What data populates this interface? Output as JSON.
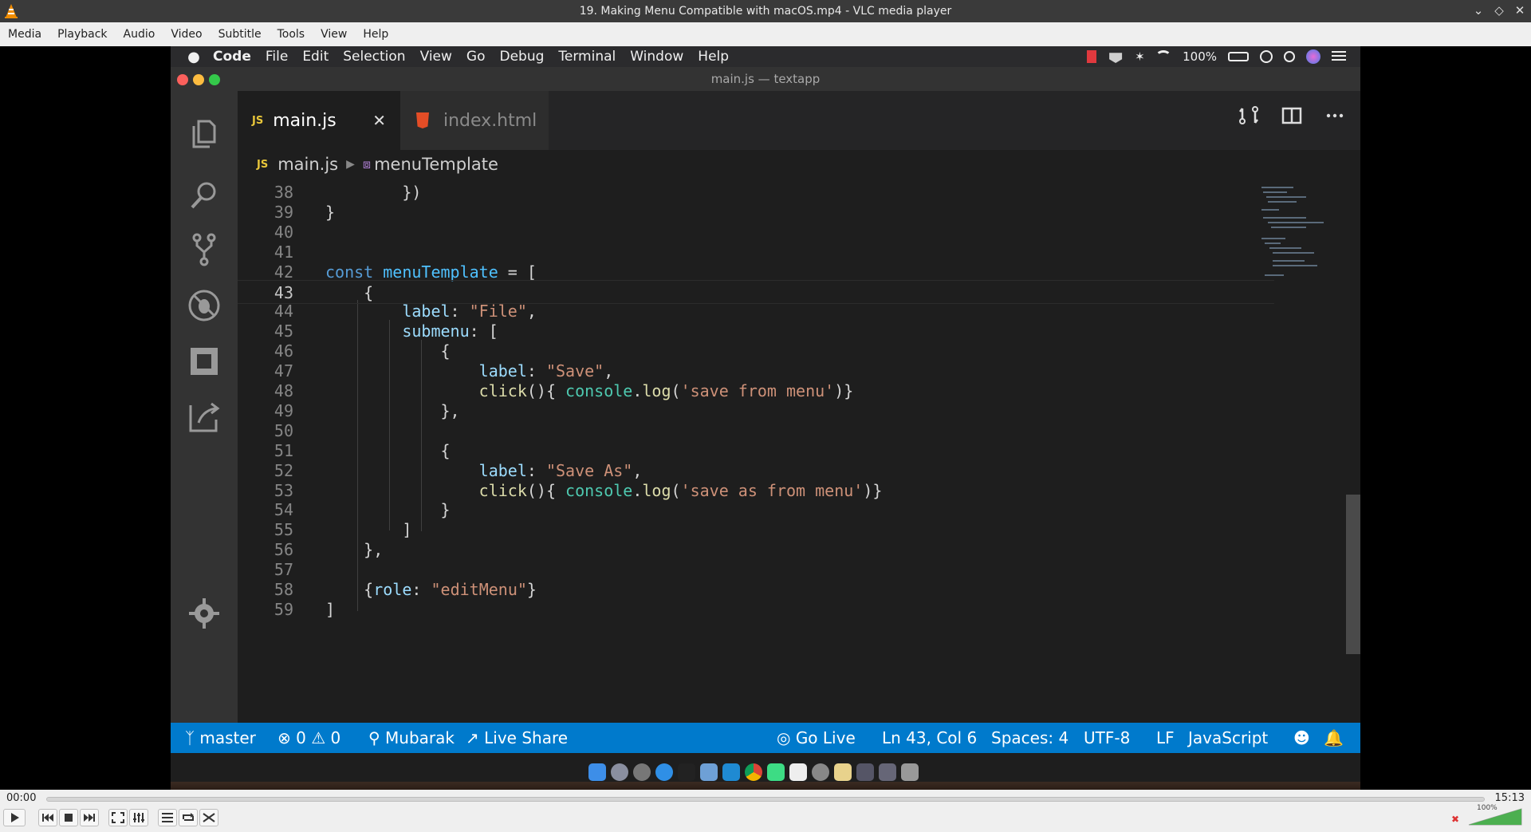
{
  "vlc": {
    "window_title": "19. Making Menu Compatible with macOS.mp4 - VLC media player",
    "menu": [
      "Media",
      "Playback",
      "Audio",
      "Video",
      "Subtitle",
      "Tools",
      "View",
      "Help"
    ],
    "time_elapsed": "00:00",
    "time_total": "15:13",
    "volume_label": "100%",
    "progress": 0.0,
    "volume": 1.0
  },
  "mac_menubar": {
    "items": [
      "Code",
      "File",
      "Edit",
      "Selection",
      "View",
      "Go",
      "Debug",
      "Terminal",
      "Window",
      "Help"
    ],
    "battery": "100%"
  },
  "vscode": {
    "window_title": "main.js — textapp",
    "tabs": [
      {
        "label": "main.js",
        "badge": "JS",
        "active": true
      },
      {
        "label": "index.html",
        "badge": "",
        "active": false
      }
    ],
    "breadcrumb": {
      "file": "main.js",
      "symbol": "menuTemplate"
    },
    "status": {
      "branch": "master",
      "errors": "0",
      "warnings": "0",
      "user": "Mubarak",
      "live_share": "Live Share",
      "go_live": "Go Live",
      "position": "Ln 43, Col 6",
      "spaces": "Spaces: 4",
      "encoding": "UTF-8",
      "eol": "LF",
      "language": "JavaScript"
    },
    "code_lines": [
      {
        "n": "38",
        "text": "        })"
      },
      {
        "n": "39",
        "text": "}"
      },
      {
        "n": "40",
        "text": ""
      },
      {
        "n": "41",
        "text": ""
      },
      {
        "n": "42",
        "text": "const menuTemplate = ["
      },
      {
        "n": "43",
        "text": "    {"
      },
      {
        "n": "44",
        "text": "        label: \"File\","
      },
      {
        "n": "45",
        "text": "        submenu: ["
      },
      {
        "n": "46",
        "text": "            {"
      },
      {
        "n": "47",
        "text": "                label: \"Save\","
      },
      {
        "n": "48",
        "text": "                click(){ console.log('save from menu')}"
      },
      {
        "n": "49",
        "text": "            },"
      },
      {
        "n": "50",
        "text": ""
      },
      {
        "n": "51",
        "text": "            {"
      },
      {
        "n": "52",
        "text": "                label: \"Save As\","
      },
      {
        "n": "53",
        "text": "                click(){ console.log('save as from menu')}"
      },
      {
        "n": "54",
        "text": "            }"
      },
      {
        "n": "55",
        "text": "        ]"
      },
      {
        "n": "56",
        "text": "    },"
      },
      {
        "n": "57",
        "text": ""
      },
      {
        "n": "58",
        "text": "    {role: \"editMenu\"}"
      },
      {
        "n": "59",
        "text": "]"
      }
    ]
  },
  "colors": {
    "statusbar": "#007acc",
    "editor_bg": "#1e1e1e",
    "activity_bg": "#333333"
  }
}
